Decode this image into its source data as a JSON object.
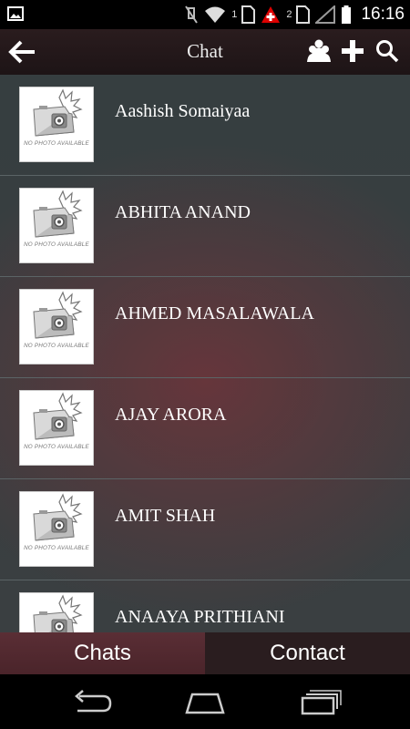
{
  "status_bar": {
    "sim1_label": "1",
    "sim2_label": "2",
    "time": "16:16"
  },
  "app_bar": {
    "title": "Chat",
    "icons": [
      "back-arrow-icon",
      "group-icon",
      "add-icon",
      "search-icon"
    ]
  },
  "contacts": [
    {
      "name": "Aashish Somaiyaa",
      "photo_placeholder": "NO PHOTO AVAILABLE"
    },
    {
      "name": "ABHITA ANAND",
      "photo_placeholder": "NO PHOTO AVAILABLE"
    },
    {
      "name": "AHMED MASALAWALA",
      "photo_placeholder": "NO PHOTO AVAILABLE"
    },
    {
      "name": "AJAY ARORA",
      "photo_placeholder": "NO PHOTO AVAILABLE"
    },
    {
      "name": "AMIT SHAH",
      "photo_placeholder": "NO PHOTO AVAILABLE"
    },
    {
      "name": "ANAAYA PRITHIANI",
      "photo_placeholder": "NO PHOTO AVAILABLE"
    }
  ],
  "tabs": {
    "chats_label": "Chats",
    "contact_label": "Contact"
  },
  "colors": {
    "selected_tab": "#5a2e35",
    "unselected_tab": "#2a1d1f",
    "list_background": "#3a3f41",
    "accent_glow": "#6e343a"
  }
}
